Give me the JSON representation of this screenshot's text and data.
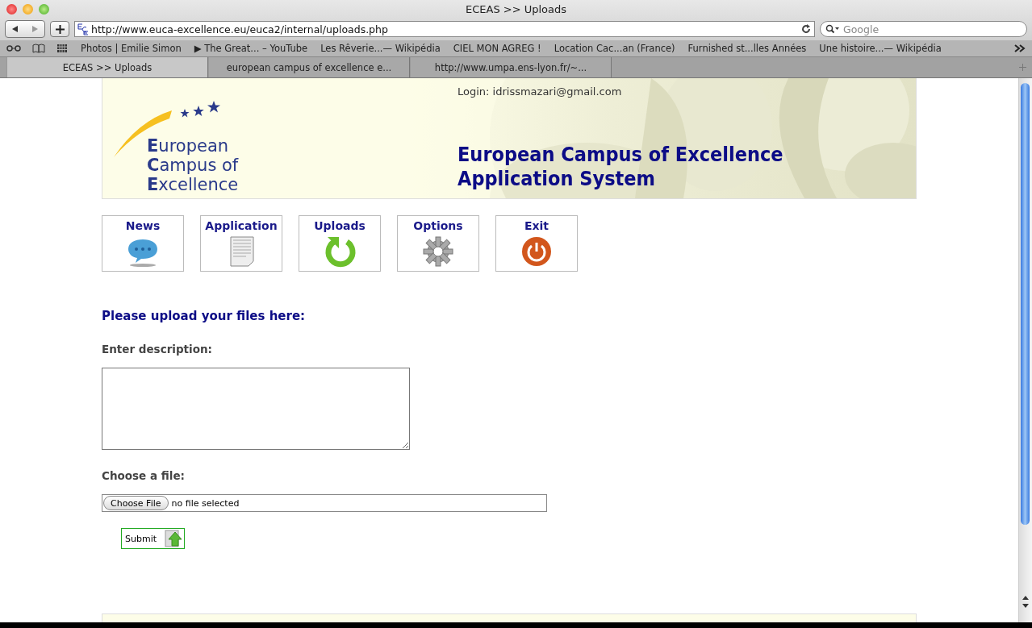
{
  "window": {
    "title": "ECEAS >> Uploads"
  },
  "toolbar": {
    "address": "http://www.euca-excellence.eu/euca2/internal/uploads.php",
    "search": {
      "placeholder": "Google"
    }
  },
  "bookmarks": [
    "Photos | Emilie Simon",
    "▶ The Great... – YouTube",
    "Les Rêverie...— Wikipédia",
    "CIEL MON AGREG !",
    "Location Cac...an (France)",
    "Furnished st...lles Années",
    "Une histoire...— Wikipédia"
  ],
  "tabs": [
    {
      "label": "ECEAS >> Uploads",
      "selected": true
    },
    {
      "label": "european campus of excellence e...",
      "selected": false
    },
    {
      "label": "http://www.umpa.ens-lyon.fr/~...",
      "selected": false
    }
  ],
  "banner": {
    "logo": [
      "**E**uropean",
      "**C**ampus of",
      "**E**xcellence"
    ],
    "login": "Login: idrissmazari@gmail.com",
    "title": [
      "European Campus of Excellence",
      "Application System"
    ],
    "kind": "picture"
  },
  "nav": [
    {
      "label": "News",
      "kind": "news"
    },
    {
      "label": "Application",
      "kind": "document"
    },
    {
      "label": "Uploads",
      "kind": "uploads"
    },
    {
      "label": "Options",
      "kind": "options"
    },
    {
      "label": "Exit",
      "kind": "exit"
    }
  ],
  "form": {
    "heading": "Please upload your files here:",
    "description_label": "Enter description:",
    "file_label": "Choose a file:",
    "choose_button": "Choose File",
    "file_status": "no file selected",
    "submit": "Submit"
  }
}
